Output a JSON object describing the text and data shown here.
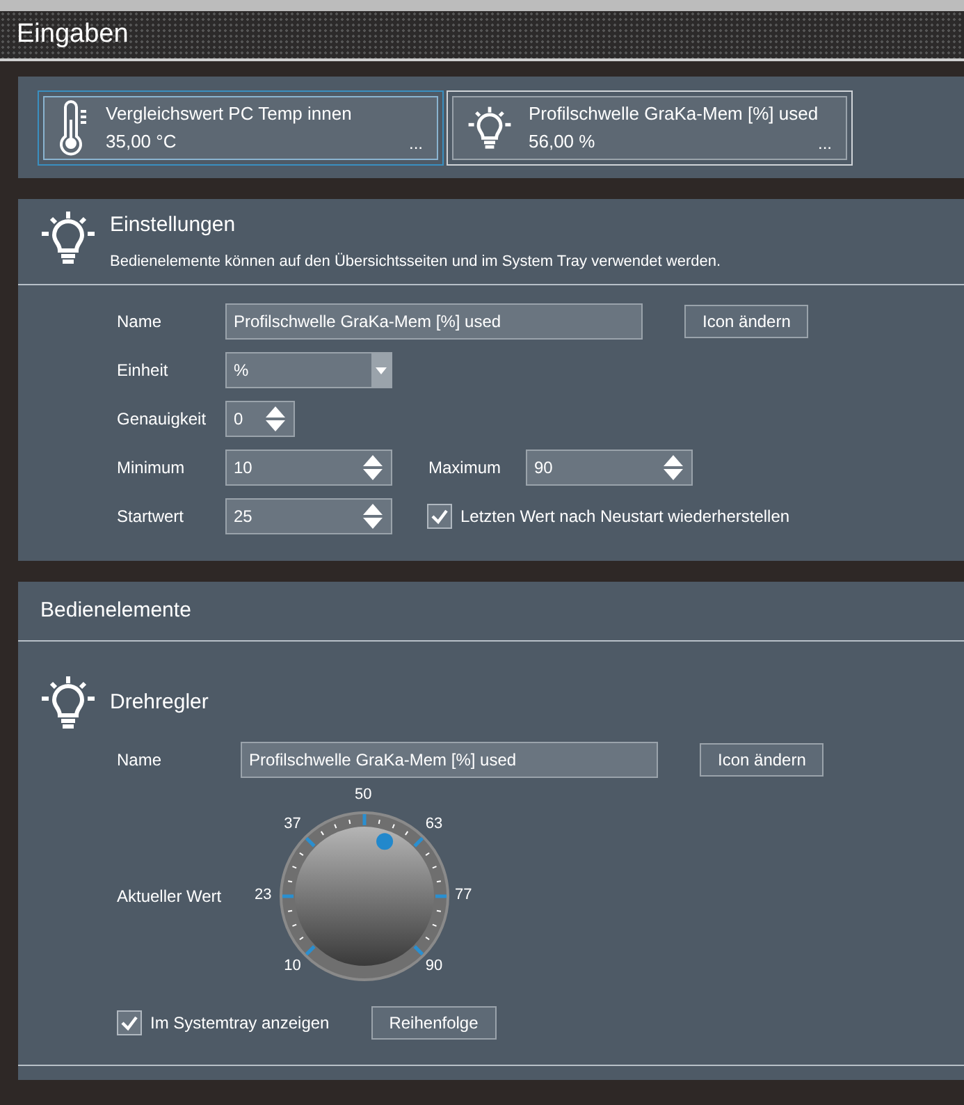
{
  "header": {
    "title": "Eingaben"
  },
  "inputs": [
    {
      "kind": "thermometer",
      "title": "Vergleichswert PC Temp innen",
      "value": "35,00 °C",
      "more": "...",
      "selected": false,
      "hovered": true
    },
    {
      "kind": "bulb",
      "title": "Profilschwelle GraKa-Mem [%] used",
      "value": "56,00 %",
      "more": "...",
      "selected": true,
      "hovered": false
    }
  ],
  "settings": {
    "title": "Einstellungen",
    "description": "Bedienelemente können auf den Übersichtsseiten und im System Tray verwendet werden.",
    "name_label": "Name",
    "name_value": "Profilschwelle GraKa-Mem [%] used",
    "icon_button": "Icon ändern",
    "unit_label": "Einheit",
    "unit_value": "%",
    "precision_label": "Genauigkeit",
    "precision_value": "0",
    "min_label": "Minimum",
    "min_value": "10",
    "max_label": "Maximum",
    "max_value": "90",
    "start_label": "Startwert",
    "start_value": "25",
    "restore": {
      "label": "Letzten Wert nach Neustart wiederherstellen",
      "checked": true
    }
  },
  "controls": {
    "title": "Bedienelemente",
    "control_title": "Drehregler",
    "name_label": "Name",
    "name_value": "Profilschwelle GraKa-Mem [%] used",
    "icon_button": "Icon ändern",
    "value_label": "Aktueller Wert",
    "dial": {
      "level": 0.575,
      "ticks": [
        "10",
        "23",
        "37",
        "50",
        "63",
        "77",
        "90"
      ]
    },
    "tray": {
      "label": "Im Systemtray anzeigen",
      "checked": true
    },
    "order_button": "Reihenfolge"
  }
}
